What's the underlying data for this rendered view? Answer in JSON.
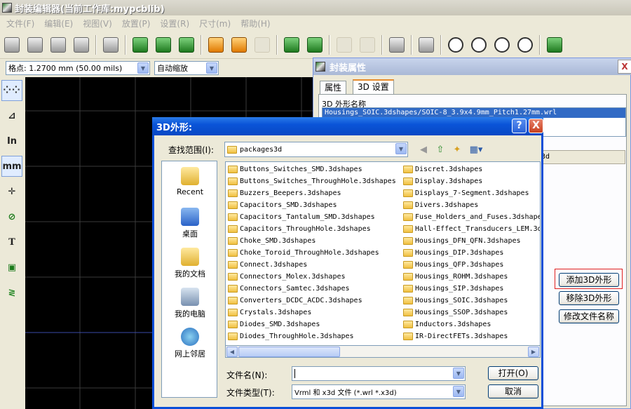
{
  "main_window": {
    "title": "封装编辑器(当前工作库:mypcblib)"
  },
  "menu": [
    "文件(F)",
    "编辑(E)",
    "视图(V)",
    "放置(P)",
    "设置(R)",
    "尺寸(m)",
    "帮助(H)"
  ],
  "toolbar2": {
    "grid_value": "格点: 1.2700 mm (50.00 mils)",
    "zoom_value": "自动缩放"
  },
  "left_toolbar": {
    "inch_label": "In",
    "mm_label": "mm"
  },
  "footprint_props": {
    "title": "封装属性",
    "close": "X",
    "tabs": [
      "属性",
      "3D 设置"
    ],
    "shape_list_label": "3D 外形名称",
    "shape_list_items": [
      "Housings_SOIC.3dshapes/SOIC-8_3.9x4.9mm_Pitch1.27mm.wrl"
    ],
    "field_value": "3d",
    "buttons": {
      "add": "添加3D外形",
      "remove": "移除3D外形",
      "rename": "修改文件名称"
    }
  },
  "dialog": {
    "title": "3D外形:",
    "help": "?",
    "close": "X",
    "look_in_label": "查找范围(I):",
    "look_in_value": "packages3d",
    "places": [
      "Recent",
      "桌面",
      "我的文档",
      "我的电脑",
      "网上邻居"
    ],
    "files_col1": [
      "Buttons_Switches_SMD.3dshapes",
      "Buttons_Switches_ThroughHole.3dshapes",
      "Buzzers_Beepers.3dshapes",
      "Capacitors_SMD.3dshapes",
      "Capacitors_Tantalum_SMD.3dshapes",
      "Capacitors_ThroughHole.3dshapes",
      "Choke_SMD.3dshapes",
      "Choke_Toroid_ThroughHole.3dshapes",
      "Connect.3dshapes",
      "Connectors_Molex.3dshapes",
      "Connectors_Samtec.3dshapes",
      "Converters_DCDC_ACDC.3dshapes",
      "Crystals.3dshapes",
      "Diodes_SMD.3dshapes",
      "Diodes_ThroughHole.3dshapes"
    ],
    "files_col2": [
      "Discret.3dshapes",
      "Display.3dshapes",
      "Displays_7-Segment.3dshapes",
      "Divers.3dshapes",
      "Fuse_Holders_and_Fuses.3dshapes",
      "Hall-Effect_Transducers_LEM.3dshapes",
      "Housings_DFN_QFN.3dshapes",
      "Housings_DIP.3dshapes",
      "Housings_QFP.3dshapes",
      "Housings_ROHM.3dshapes",
      "Housings_SIP.3dshapes",
      "Housings_SOIC.3dshapes",
      "Housings_SSOP.3dshapes",
      "Inductors.3dshapes",
      "IR-DirectFETs.3dshapes"
    ],
    "filename_label": "文件名(N):",
    "filename_value": "",
    "filetype_label": "文件类型(T):",
    "filetype_value": "Vrml 和 x3d 文件 (*.wrl *.x3d)",
    "open_button": "打开(O)",
    "cancel_button": "取消"
  }
}
